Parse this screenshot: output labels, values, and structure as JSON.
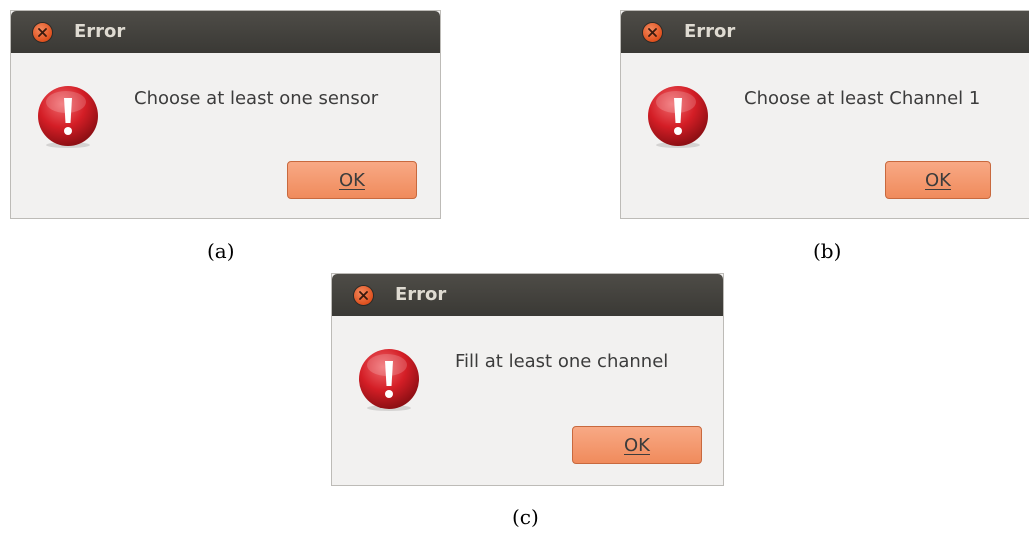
{
  "dialogs": [
    {
      "title": "Error",
      "message": "Choose at least one sensor",
      "button_label": "OK",
      "caption": "(a)"
    },
    {
      "title": "Error",
      "message": "Choose at least Channel 1",
      "button_label": "OK",
      "caption": "(b)"
    },
    {
      "title": "Error",
      "message": "Fill at least one channel",
      "button_label": "OK",
      "caption": "(c)"
    }
  ],
  "icons": {
    "close": "close-icon",
    "error": "error-icon"
  },
  "colors": {
    "titlebar": "#3f3e3a",
    "dialog_bg": "#f2f1f0",
    "close_button": "#e95420",
    "ok_button": "#f4996d",
    "error_icon": "#d81f26"
  }
}
